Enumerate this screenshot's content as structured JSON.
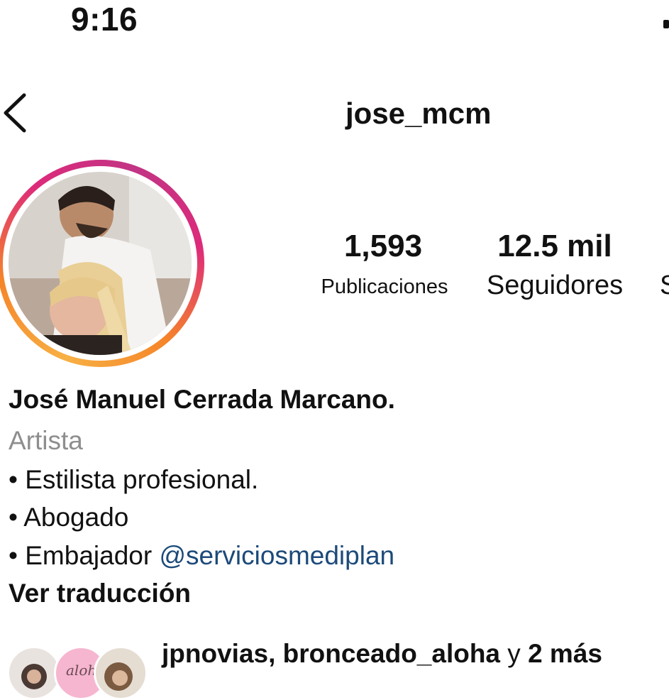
{
  "status_bar": {
    "time": "9:16"
  },
  "header": {
    "username": "jose_mcm",
    "back_icon": "chevron-left-icon"
  },
  "profile": {
    "avatar_alt": "profile photo",
    "stats": [
      {
        "value": "1,593",
        "label": "Publicaciones"
      },
      {
        "value": "12.5 mil",
        "label": "Seguidores"
      },
      {
        "label": "S"
      }
    ],
    "name": "José Manuel Cerrada Marcano.",
    "category": "Artista",
    "bio": [
      {
        "bullet": "•",
        "text": "Estilista profesional."
      },
      {
        "bullet": "•",
        "text": "Abogado"
      },
      {
        "bullet": "•",
        "text": "Embajador ",
        "mention": "@serviciosmediplan"
      }
    ],
    "translate_label": "Ver traducción",
    "followed_by": {
      "names": "jpnovias, bronceado_aloha",
      "connector": " y ",
      "more": "2 más"
    }
  },
  "colors": {
    "story_ring": [
      "#f7b044",
      "#f58529",
      "#dd2a7b",
      "#c13584"
    ],
    "mention": "#1c4a7a",
    "category": "#8e8e8e"
  }
}
